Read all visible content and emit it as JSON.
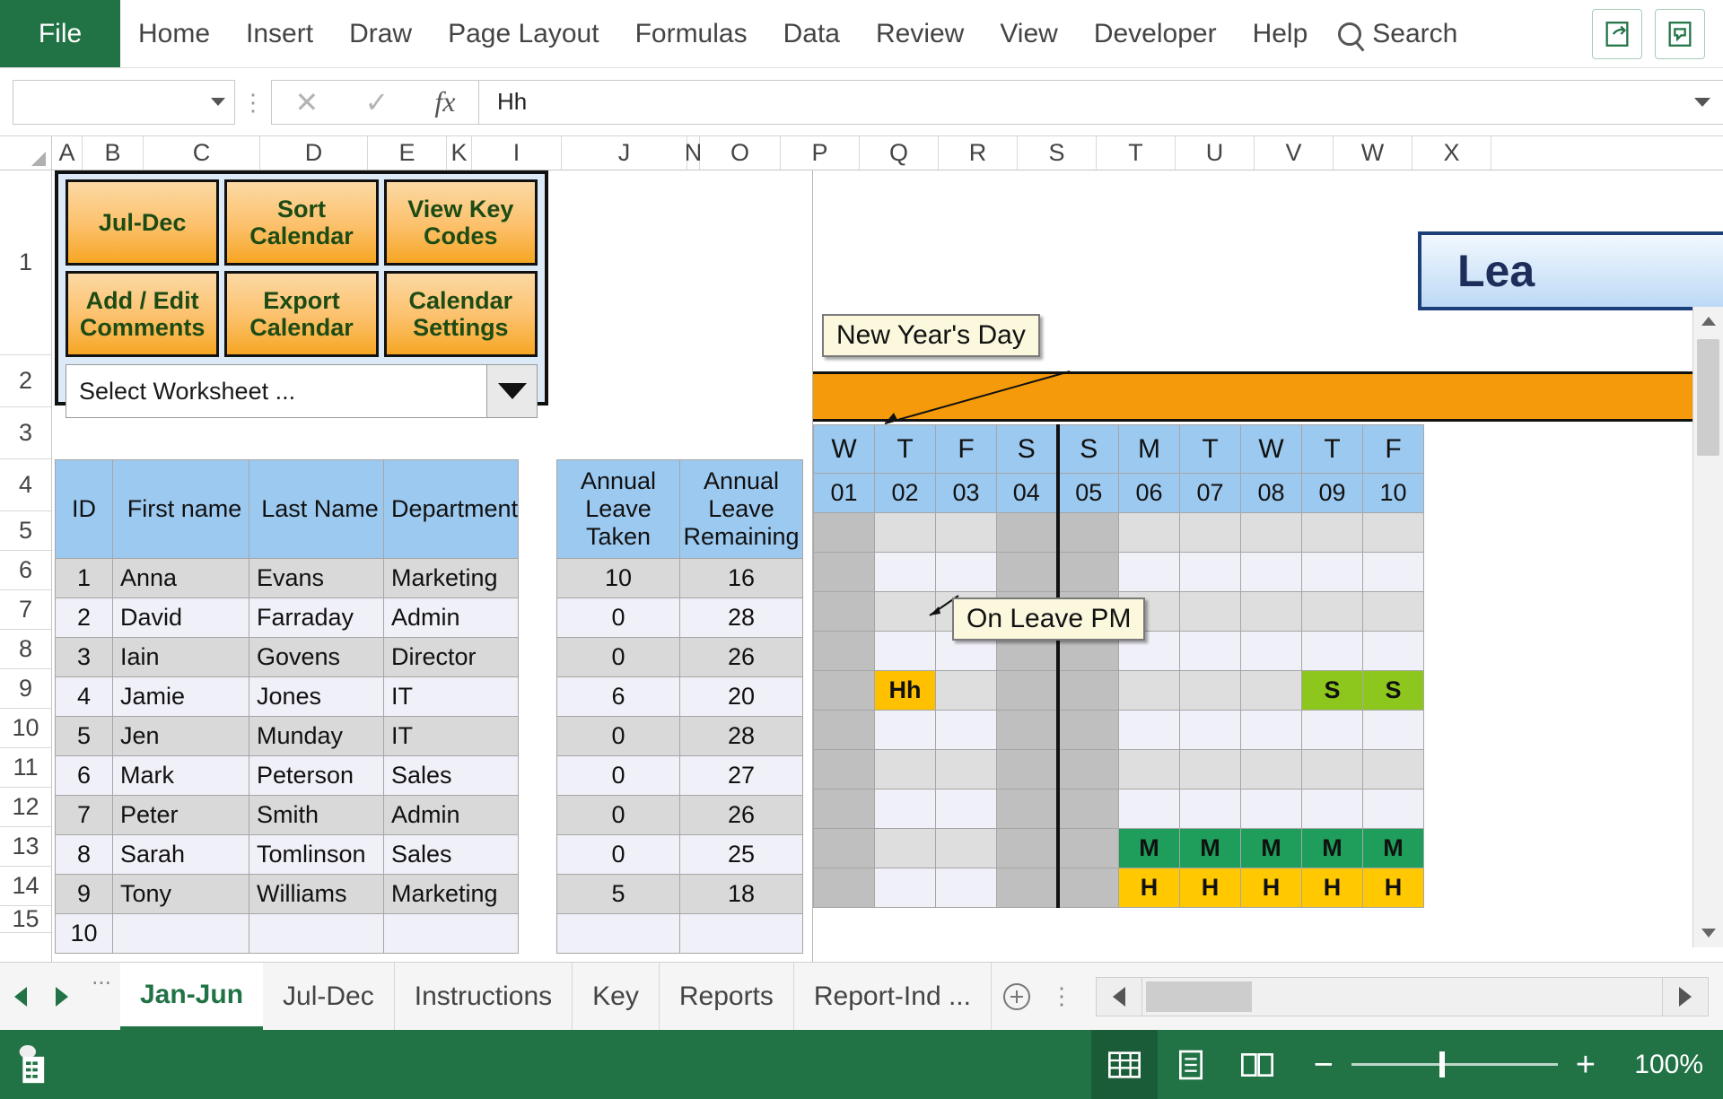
{
  "ribbon": {
    "file_label": "File",
    "tabs": [
      "Home",
      "Insert",
      "Draw",
      "Page Layout",
      "Formulas",
      "Data",
      "Review",
      "View",
      "Developer",
      "Help"
    ],
    "search_label": "Search",
    "share_icon": "share-icon",
    "comments_icon": "comment-icon"
  },
  "formula_bar": {
    "name_box_value": "",
    "cancel_icon": "cancel-icon",
    "enter_icon": "confirm-icon",
    "fx_icon": "insert-function-icon",
    "formula_value": "Hh"
  },
  "grid": {
    "columns": [
      "A",
      "B",
      "C",
      "D",
      "E",
      "K",
      "I",
      "J",
      "N",
      "O",
      "P",
      "Q",
      "R",
      "S",
      "T",
      "U",
      "V",
      "W",
      "X"
    ],
    "rows": [
      "1",
      "2",
      "3",
      "4",
      "5",
      "6",
      "7",
      "8",
      "9",
      "10",
      "11",
      "12",
      "13",
      "14",
      "15"
    ]
  },
  "panel": {
    "buttons": [
      "Jul-Dec",
      "Sort Calendar",
      "View Key Codes",
      "Add / Edit Comments",
      "Export Calendar",
      "Calendar Settings"
    ],
    "worksheet_select_label": "Select Worksheet ..."
  },
  "employee_table": {
    "headers": [
      "ID",
      "First name",
      "Last Name",
      "Department"
    ],
    "rows": [
      {
        "id": "1",
        "first": "Anna",
        "last": "Evans",
        "dept": "Marketing"
      },
      {
        "id": "2",
        "first": "David",
        "last": "Farraday",
        "dept": "Admin"
      },
      {
        "id": "3",
        "first": "Iain",
        "last": "Govens",
        "dept": "Director"
      },
      {
        "id": "4",
        "first": "Jamie",
        "last": "Jones",
        "dept": "IT"
      },
      {
        "id": "5",
        "first": "Jen",
        "last": "Munday",
        "dept": "IT"
      },
      {
        "id": "6",
        "first": "Mark",
        "last": "Peterson",
        "dept": "Sales"
      },
      {
        "id": "7",
        "first": "Peter",
        "last": "Smith",
        "dept": "Admin"
      },
      {
        "id": "8",
        "first": "Sarah",
        "last": "Tomlinson",
        "dept": "Sales"
      },
      {
        "id": "9",
        "first": "Tony",
        "last": "Williams",
        "dept": "Marketing"
      },
      {
        "id": "10",
        "first": "",
        "last": "",
        "dept": ""
      }
    ]
  },
  "leave_table": {
    "headers": [
      "Annual Leave Taken",
      "Annual Leave Remaining"
    ],
    "rows": [
      {
        "taken": "10",
        "remaining": "16"
      },
      {
        "taken": "0",
        "remaining": "28"
      },
      {
        "taken": "0",
        "remaining": "26"
      },
      {
        "taken": "6",
        "remaining": "20"
      },
      {
        "taken": "0",
        "remaining": "28"
      },
      {
        "taken": "0",
        "remaining": "27"
      },
      {
        "taken": "0",
        "remaining": "26"
      },
      {
        "taken": "0",
        "remaining": "25"
      },
      {
        "taken": "5",
        "remaining": "18"
      },
      {
        "taken": "",
        "remaining": ""
      }
    ]
  },
  "calendar": {
    "title": "Lea",
    "day_letters": [
      "W",
      "T",
      "F",
      "S",
      "S",
      "M",
      "T",
      "W",
      "T",
      "F"
    ],
    "day_numbers": [
      "01",
      "02",
      "03",
      "04",
      "05",
      "06",
      "07",
      "08",
      "09",
      "10"
    ],
    "marked_cells": [
      {
        "row": 4,
        "col": 1,
        "text": "Hh",
        "kind": "halfday"
      },
      {
        "row": 4,
        "col": 8,
        "text": "S",
        "kind": "sick"
      },
      {
        "row": 4,
        "col": 9,
        "text": "S",
        "kind": "sick"
      },
      {
        "row": 8,
        "col": 5,
        "text": "M",
        "kind": "maternity"
      },
      {
        "row": 8,
        "col": 6,
        "text": "M",
        "kind": "maternity"
      },
      {
        "row": 8,
        "col": 7,
        "text": "M",
        "kind": "maternity"
      },
      {
        "row": 8,
        "col": 8,
        "text": "M",
        "kind": "maternity"
      },
      {
        "row": 8,
        "col": 9,
        "text": "M",
        "kind": "maternity"
      },
      {
        "row": 9,
        "col": 5,
        "text": "H",
        "kind": "holiday"
      },
      {
        "row": 9,
        "col": 6,
        "text": "H",
        "kind": "holiday"
      },
      {
        "row": 9,
        "col": 7,
        "text": "H",
        "kind": "holiday"
      },
      {
        "row": 9,
        "col": 8,
        "text": "H",
        "kind": "holiday"
      },
      {
        "row": 9,
        "col": 9,
        "text": "H",
        "kind": "holiday"
      }
    ],
    "comments": {
      "new_year": "New Year's Day",
      "on_leave_pm": "On Leave PM"
    }
  },
  "colors": {
    "accent_green": "#217346",
    "header_blue": "#9CC9F0",
    "button_orange": "#F6A623",
    "orange_bar": "#F59B0B",
    "halfday_amber": "#FFC000",
    "sick_green": "#8DC71E",
    "maternity_green": "#1E9E5A",
    "holiday_yellow": "#FFC800",
    "comment_bg": "#FBF8DD"
  },
  "sheet_tabs": {
    "overflow_label": "...",
    "tabs": [
      "Jan-Jun",
      "Jul-Dec",
      "Instructions",
      "Key",
      "Reports",
      "Report-Ind ..."
    ],
    "active": "Jan-Jun"
  },
  "status_bar": {
    "ready_icon": "workbook-stats-icon",
    "views": [
      "normal-view-icon",
      "page-layout-icon",
      "page-break-icon"
    ],
    "zoom_out_label": "−",
    "zoom_in_label": "+",
    "zoom_level": "100%"
  }
}
